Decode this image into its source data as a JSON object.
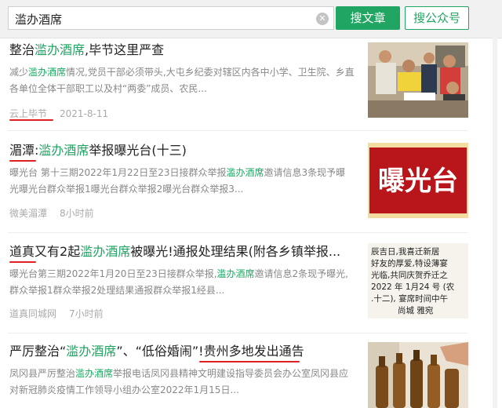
{
  "search": {
    "query": "滥办酒席",
    "clear_icon": "clear-icon",
    "btn_article": "搜文章",
    "btn_account": "搜公众号"
  },
  "results": [
    {
      "title_parts": [
        {
          "text": "整治",
          "hl": false
        },
        {
          "text": "滥办酒席",
          "hl": true
        },
        {
          "text": ",毕节这里严查",
          "hl": false
        }
      ],
      "desc_parts": [
        {
          "text": "减少",
          "hl": false
        },
        {
          "text": "滥办酒席",
          "hl": true
        },
        {
          "text": "情况,党员干部必须带头,大屯乡纪委对辖区内各中小学、卫生院、乡直各单位全体干部职工以及村“两委”成员、农民...",
          "hl": false
        }
      ],
      "source": "云上毕节",
      "time": "2021-8-11",
      "image": "photo of officials visiting villagers"
    },
    {
      "title_parts": [
        {
          "text": "湄潭",
          "hl": false
        },
        {
          "text": ":",
          "hl": false
        },
        {
          "text": "滥办酒席",
          "hl": true
        },
        {
          "text": "举报曝光台(十三)",
          "hl": false
        }
      ],
      "desc_parts": [
        {
          "text": "曝光台 第十三期2022年1月22日至23日接群众举报",
          "hl": false
        },
        {
          "text": "滥办酒席",
          "hl": true
        },
        {
          "text": "邀请信息3条现予曝光曝光台群众举报1曝光台群众举报2曝光台群众举报3...",
          "hl": false
        }
      ],
      "source": "微美湄潭",
      "time": "8小时前",
      "image_text": "曝光台"
    },
    {
      "title_parts": [
        {
          "text": "道真",
          "hl": false
        },
        {
          "text": "又有2起",
          "hl": false
        },
        {
          "text": "滥办酒席",
          "hl": true
        },
        {
          "text": "被曝光!通报处理结果(附各乡镇举报...",
          "hl": false
        }
      ],
      "desc_parts": [
        {
          "text": "曝光台第三期2022年1月20日至23日接群众举报,",
          "hl": false
        },
        {
          "text": "滥办酒席",
          "hl": true
        },
        {
          "text": "邀请信息2条现予曝光,群众举报1群众举报2处理结果通报群众举报1经县...",
          "hl": false
        }
      ],
      "source": "道真同城网",
      "time": "7小时前",
      "image_lines": [
        "辰吉日,我喜迁新居",
        "好友的厚爱,特设薄宴",
        "光临,共同庆贺乔迁之",
        "2022 年 1月24 号 (农",
        ".十二), 宴席时间中午",
        "尚城 雅宛"
      ]
    },
    {
      "title_parts": [
        {
          "text": "严厉整治“",
          "hl": false
        },
        {
          "text": "滥办酒席",
          "hl": true
        },
        {
          "text": "”、“低俗婚闹”!贵州多地发出通告",
          "hl": false
        }
      ],
      "desc_parts": [
        {
          "text": "凤冈县严厉整治",
          "hl": false
        },
        {
          "text": "滥办酒席",
          "hl": true
        },
        {
          "text": "举报电话凤冈县精神文明建设指导委员会办公室凤冈县应对新冠肺炎疫情工作领导小组办公室2022年1月15日...",
          "hl": false
        }
      ],
      "source": "",
      "time": "",
      "image": "photo of beer bottles toasting"
    }
  ],
  "colors": {
    "accent": "#21a562",
    "underline": "#e02020",
    "muted": "#888888"
  }
}
